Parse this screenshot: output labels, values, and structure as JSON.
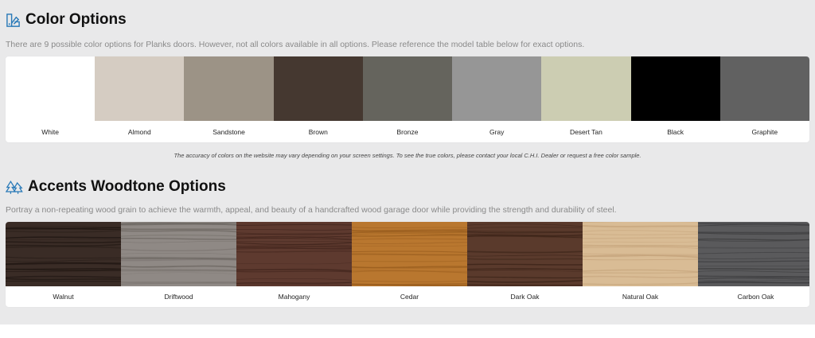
{
  "colors_section": {
    "title": "Color Options",
    "subtitle": "There are 9 possible color options for Planks doors. However, not all colors available in all options. Please reference the model table below for exact options.",
    "swatches": [
      {
        "label": "White",
        "color": "#ffffff"
      },
      {
        "label": "Almond",
        "color": "#d5ccc2"
      },
      {
        "label": "Sandstone",
        "color": "#9c9386"
      },
      {
        "label": "Brown",
        "color": "#453830"
      },
      {
        "label": "Bronze",
        "color": "#65645d"
      },
      {
        "label": "Gray",
        "color": "#969696"
      },
      {
        "label": "Desert Tan",
        "color": "#cccdb2"
      },
      {
        "label": "Black",
        "color": "#000000"
      },
      {
        "label": "Graphite",
        "color": "#616161"
      }
    ],
    "note": "The accuracy of colors on the website may vary depending on your screen settings. To see the true colors, please contact your local C.H.I. Dealer or request a free color sample."
  },
  "woodtone_section": {
    "title": "Accents Woodtone Options",
    "subtitle": "Portray a non-repeating wood grain to achieve the warmth, appeal, and beauty of a handcrafted wood garage door while providing the strength and durability of steel.",
    "swatches": [
      {
        "label": "Walnut",
        "base": "#3a2c26",
        "grain": "#1f1612"
      },
      {
        "label": "Driftwood",
        "base": "#8f8985",
        "grain": "#6b6560"
      },
      {
        "label": "Mahogany",
        "base": "#5e3a2f",
        "grain": "#3a1f18"
      },
      {
        "label": "Cedar",
        "base": "#b9772f",
        "grain": "#9a5e1f"
      },
      {
        "label": "Dark Oak",
        "base": "#5a3a2c",
        "grain": "#3c2419"
      },
      {
        "label": "Natural Oak",
        "base": "#d9bc95",
        "grain": "#c4a27a"
      },
      {
        "label": "Carbon Oak",
        "base": "#5a5a5c",
        "grain": "#3d3d3f"
      }
    ]
  }
}
